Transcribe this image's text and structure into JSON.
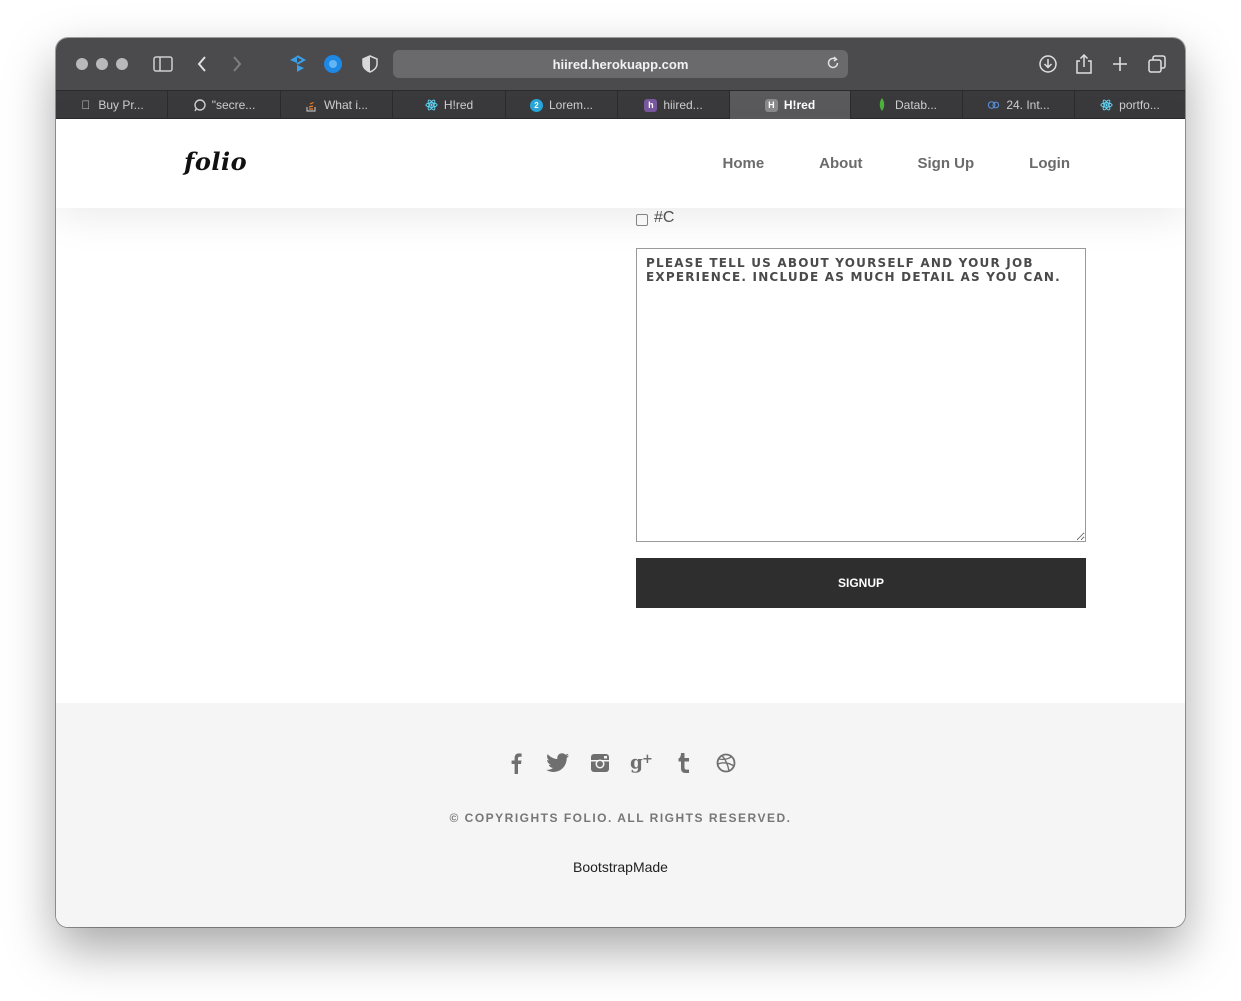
{
  "browser": {
    "url": "hiired.herokuapp.com",
    "tabs": [
      {
        "label": "Buy Pr...",
        "icon": "apple-icon",
        "active": false
      },
      {
        "label": "\"secre...",
        "icon": "chat-icon",
        "active": false
      },
      {
        "label": "What i...",
        "icon": "stackoverflow-icon",
        "active": false
      },
      {
        "label": "H!red",
        "icon": "react-icon",
        "active": false
      },
      {
        "label": "Lorem...",
        "icon": "globe-icon",
        "active": false
      },
      {
        "label": "hiired...",
        "icon": "heroku-icon",
        "active": false
      },
      {
        "label": "H!red",
        "icon": "h-icon",
        "active": true
      },
      {
        "label": "Datab...",
        "icon": "mongodb-icon",
        "active": false
      },
      {
        "label": "24. Int...",
        "icon": "cloud-icon",
        "active": false
      },
      {
        "label": "portfo...",
        "icon": "react-icon",
        "active": false
      }
    ]
  },
  "nav": {
    "brand": "folio",
    "links": [
      "Home",
      "About",
      "Sign Up",
      "Login"
    ]
  },
  "form": {
    "checkbox_label": "#C",
    "textarea_placeholder": "PLEASE TELL US ABOUT YOURSELF AND YOUR JOB EXPERIENCE. INCLUDE AS MUCH DETAIL AS YOU CAN.",
    "submit_label": "SIGNUP"
  },
  "footer": {
    "socials": [
      "facebook-icon",
      "twitter-icon",
      "instagram-icon",
      "google-plus-icon",
      "tumblr-icon",
      "dribbble-icon"
    ],
    "copyright": "© COPYRIGHTS FOLIO. ALL RIGHTS RESERVED.",
    "credit": "BootstrapMade"
  },
  "colors": {
    "toolbar": "#4b4a4c",
    "tabbar": "#3a393b",
    "button": "#2e2e2e",
    "footer": "#f5f5f5"
  }
}
